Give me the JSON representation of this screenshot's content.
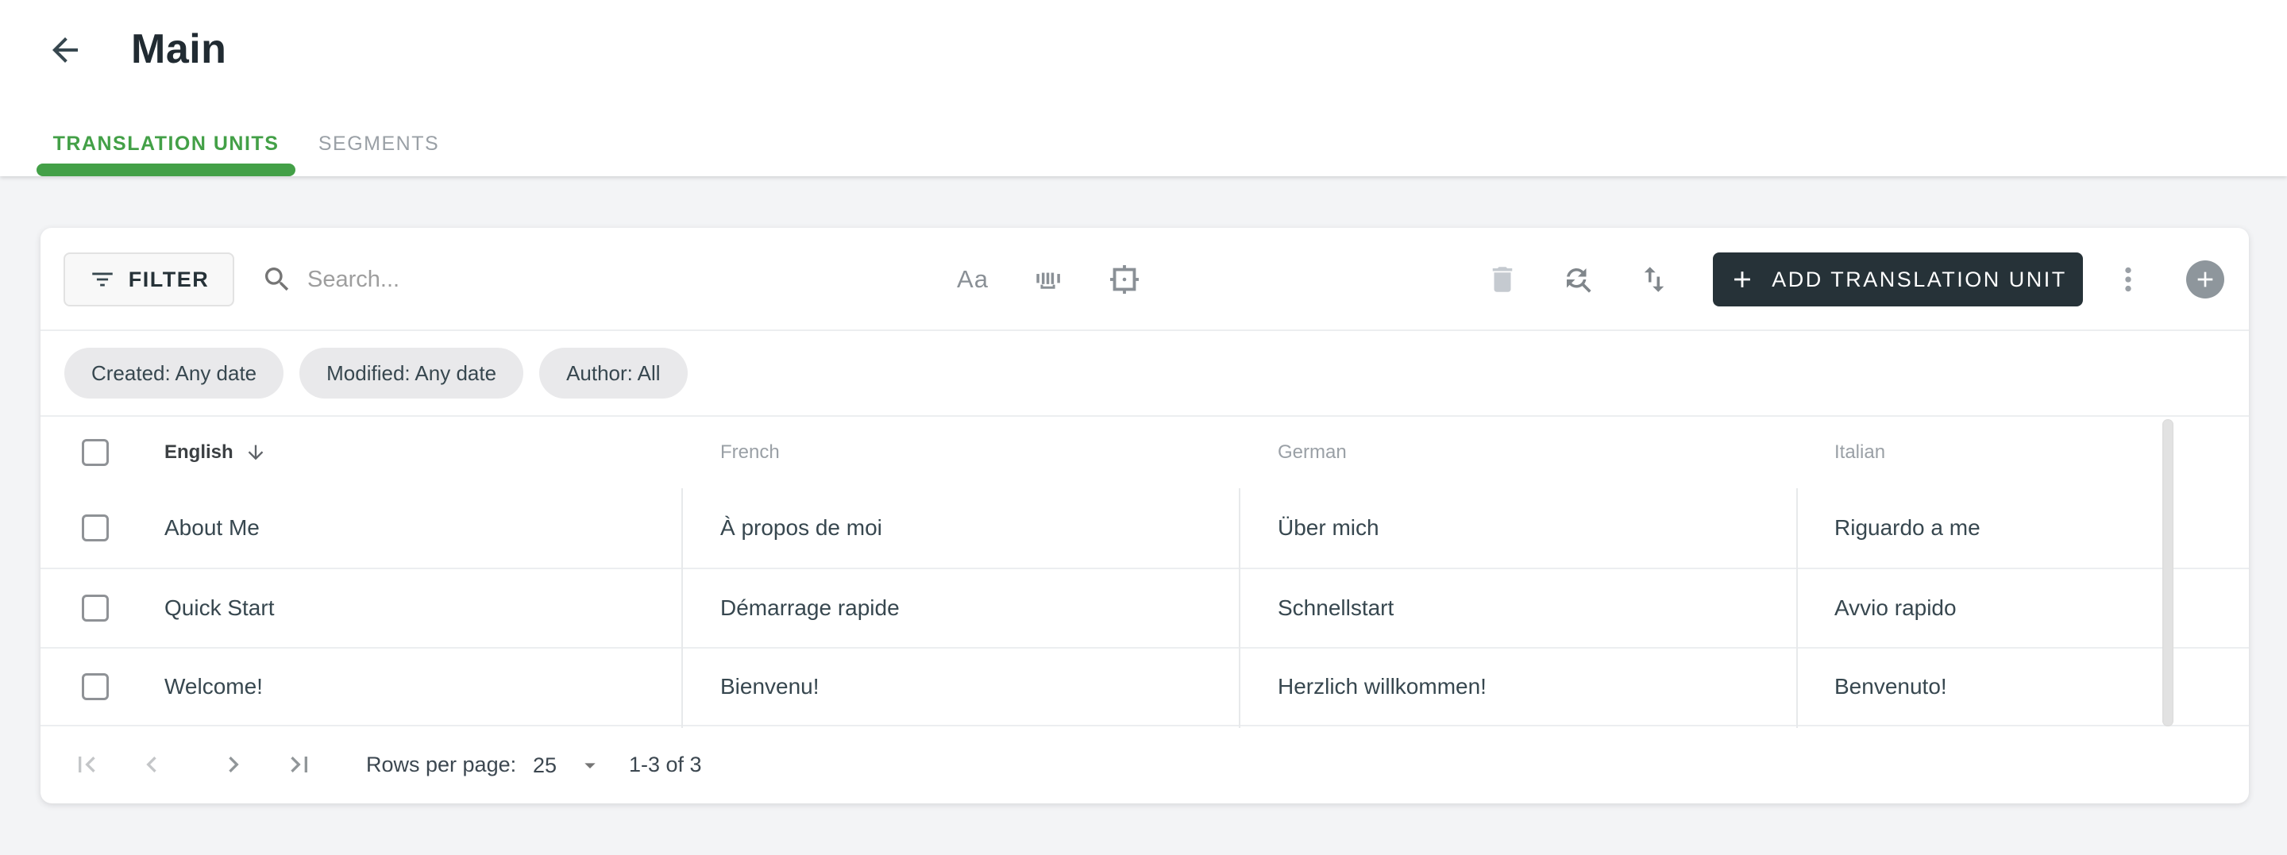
{
  "header": {
    "title": "Main",
    "back_icon": "arrow-left"
  },
  "tabs": [
    {
      "label": "TRANSLATION UNITS",
      "active": true
    },
    {
      "label": "SEGMENTS",
      "active": false
    }
  ],
  "toolbar": {
    "filter_label": "FILTER",
    "search_placeholder": "Search...",
    "search_value": "",
    "match_case_label": "Aa",
    "icons": [
      "filter-icon",
      "search-icon",
      "match-case-icon",
      "whole-word-icon",
      "placeholder-frame-icon",
      "trash-icon",
      "find-replace-icon",
      "sort-icon",
      "plus-icon",
      "kebab-icon",
      "add-circle-icon"
    ],
    "add_button_label": "ADD TRANSLATION UNIT"
  },
  "filter_chips": [
    {
      "label": "Created: Any date"
    },
    {
      "label": "Modified: Any date"
    },
    {
      "label": "Author: All"
    }
  ],
  "table": {
    "columns": [
      "English",
      "French",
      "German",
      "Italian"
    ],
    "sort": {
      "column": "English",
      "direction": "descending"
    },
    "rows": [
      {
        "cells": [
          "About Me",
          "À propos de moi",
          "Über mich",
          "Riguardo a me"
        ]
      },
      {
        "cells": [
          "Quick Start",
          "Démarrage rapide",
          "Schnellstart",
          "Avvio rapido"
        ]
      },
      {
        "cells": [
          "Welcome!",
          "Bienvenu!",
          "Herzlich willkommen!",
          "Benvenuto!"
        ]
      }
    ]
  },
  "pagination": {
    "rows_per_page_label": "Rows per page:",
    "rows_per_page_value": "25",
    "range_label": "1-3 of 3"
  },
  "colors": {
    "accent_green": "#43a047",
    "dark_button": "#263238",
    "page_background": "#f3f4f6",
    "chip_background": "#e9e9eb",
    "row_text": "#37474f",
    "muted_label": "#9aa0a6",
    "border": "#eceef0",
    "disabled_icon": "#c5cad0",
    "icon_gray": "#80868b",
    "mini_fab_gray": "#8e969c"
  }
}
